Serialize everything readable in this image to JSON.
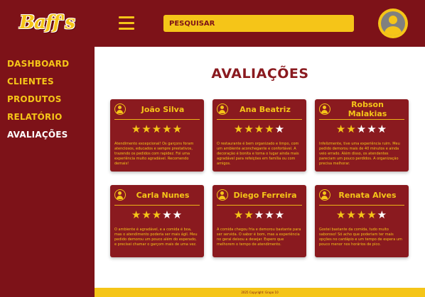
{
  "brand": {
    "logo_text": "Baff's"
  },
  "sidebar": {
    "items": [
      {
        "label": "DASHBOARD"
      },
      {
        "label": "CLIENTES"
      },
      {
        "label": "PRODUTOS"
      },
      {
        "label": "RELATÓRIO"
      },
      {
        "label": "AVALIAÇÕES"
      }
    ]
  },
  "header": {
    "search_placeholder": "PESQUISAR"
  },
  "page": {
    "title": "AVALIAÇÕES"
  },
  "reviews": [
    {
      "name": "João Silva",
      "rating": 5,
      "stars": "★★★★★",
      "text": "Atendimento excepcional! Os garçons foram atenciosos, educados e sempre prestativos, trazendo os pedidos com rapidez. Foi uma experiência muito agradável. Recomendo demais!"
    },
    {
      "name": "Ana Beatriz",
      "rating": 4,
      "stars": "★★★★★",
      "text": "O restaurante é bem organizado e limpo, com um ambiente aconchegante e confortável. A decoração é bonita e torna o lugar ainda mais agradável para refeições em família ou com amigos."
    },
    {
      "name": "Robson Malakias",
      "rating": 2,
      "stars": "★★★★★",
      "text": "Infelizmente, tive uma experiência ruim. Meu pedido demorou mais de 40 minutos e ainda veio errado. Além disso, os atendentes pareciam um pouco perdidos. A organização precisa melhorar."
    },
    {
      "name": "Carla Nunes",
      "rating": 3,
      "stars": "★★★★★",
      "text": "O ambiente é agradável, e a comida é boa, mas o atendimento poderia ser mais ágil. Meu pedido demorou um pouco além do esperado, e precisei chamar o garçom mais de uma vez."
    },
    {
      "name": "Diego Ferreira",
      "rating": 2,
      "stars": "★★★★★",
      "text": "A comida chegou fria e demorou bastante para ser servida. O sabor é bom, mas a experiência no geral deixou a desejar. Espero que melhorem o tempo de atendimento."
    },
    {
      "name": "Renata Alves",
      "rating": 4,
      "stars": "★★★★★",
      "text": "Gostei bastante da comida, tudo muito saboroso! Só acho que poderiam ter mais opções no cardápio e um tempo de espera um pouco menor nos horários de pico."
    }
  ],
  "footer": {
    "text": "2025 Copyright: Grupo 10"
  },
  "colors": {
    "primary": "#7d1218",
    "card": "#8a1a1f",
    "accent": "#f5c518",
    "background": "#ffffff"
  }
}
